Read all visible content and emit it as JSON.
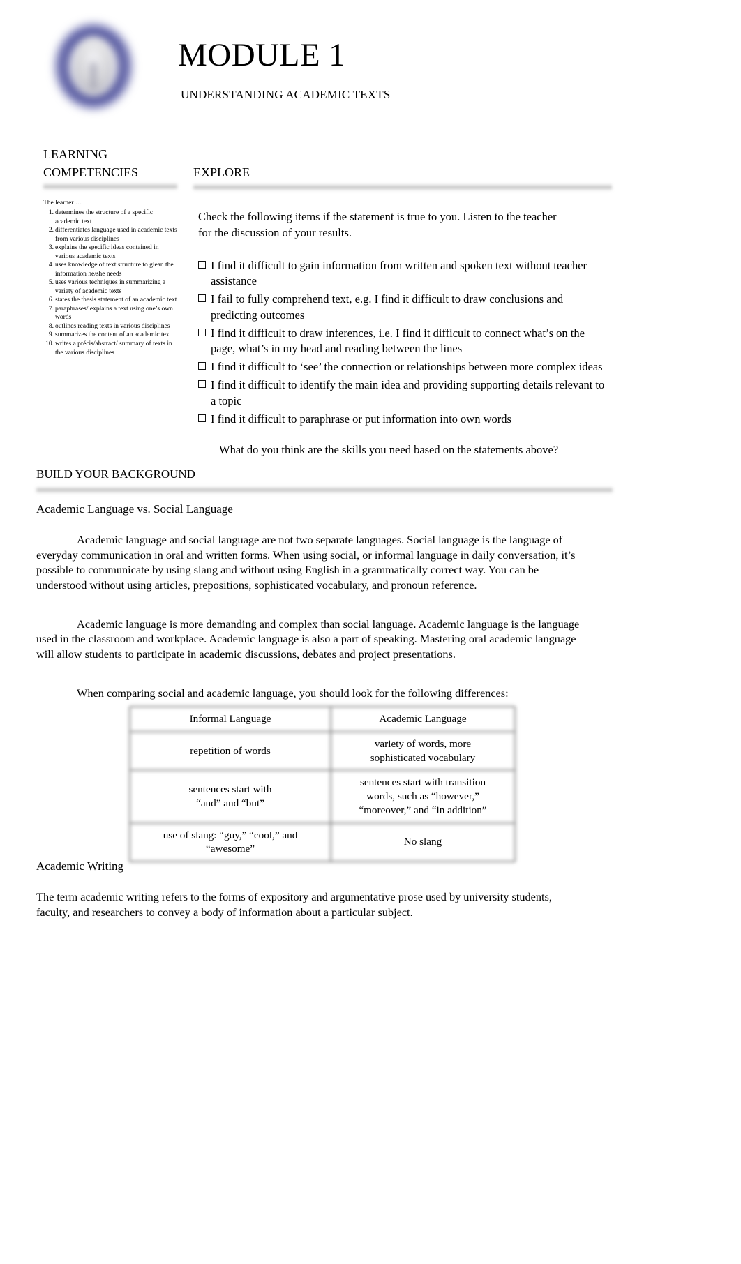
{
  "header": {
    "title": "MODULE 1",
    "subtitle": "UNDERSTANDING ACADEMIC TEXTS",
    "logo_name": "school-seal-logo"
  },
  "competencies": {
    "heading": "LEARNING\nCOMPETENCIES",
    "intro": "The learner …",
    "items": [
      {
        "num": "1.",
        "text": "determines the structure of a specific academic text"
      },
      {
        "num": "2.",
        "text": "differentiates language used in academic texts from various disciplines"
      },
      {
        "num": "3.",
        "text": "explains the specific ideas contained in various academic texts"
      },
      {
        "num": "4.",
        "text": "uses knowledge of text structure to glean the information he/she needs"
      },
      {
        "num": "5.",
        "text": "uses various techniques in summarizing a variety of academic texts"
      },
      {
        "num": "6.",
        "text": "states the thesis statement of an academic text"
      },
      {
        "num": "7.",
        "text": "paraphrases/ explains a text using one’s own words"
      },
      {
        "num": "8.",
        "text": "outlines reading texts in various disciplines"
      },
      {
        "num": "9.",
        "text": "summarizes the content of an academic text"
      },
      {
        "num": "10.",
        "text": "writes a précis/abstract/ summary of texts in the various disciplines"
      }
    ]
  },
  "explore": {
    "heading": "EXPLORE",
    "instructions": "Check the following items if the statement is true to you. Listen to the teacher for the discussion of your results.",
    "checkboxes": [
      "I find it difficult to gain information from written and spoken text without teacher assistance",
      "I fail to fully comprehend text, e.g. I find it difficult to draw conclusions and predicting outcomes",
      "I find it difficult to draw inferences, i.e.    I find it difficult to connect what’s on the page, what’s in my head and reading between the lines",
      "I find it difficult to ‘see’ the connection or relationships between more complex ideas",
      "I find it difficult to identify the main idea and providing supporting details relevant to a topic",
      "I find it difficult to paraphrase or put information into own words"
    ],
    "question": "What do you think are the skills you need based on the statements above?"
  },
  "build_background": {
    "heading": "BUILD YOUR BACKGROUND",
    "subheading": "Academic Language vs. Social Language",
    "paragraph1": "Academic language and social language are not two separate languages. Social language is the language of everyday communication in oral and written forms. When using social, or informal language in daily conversation, it’s possible to communicate by using slang and without using English in a grammatically correct way. You can be understood without using articles, prepositions, sophisticated vocabulary, and pronoun reference.",
    "paragraph2": "Academic language is more demanding and complex than social language. Academic language is the language used in the classroom and workplace. Academic language is also a part of speaking. Mastering oral academic language will allow students to participate in academic discussions, debates and project presentations.",
    "paragraph3": "When comparing social and academic language, you should look for the following differences:"
  },
  "comparison_table": {
    "headers": [
      "Informal Language",
      "Academic Language"
    ],
    "rows": [
      [
        "repetition of words",
        "variety of words, more\nsophisticated vocabulary"
      ],
      [
        "sentences start with\n“and” and “but”",
        "sentences start with transition\nwords, such as “however,”\n“moreover,” and “in addition”"
      ],
      [
        "use of slang: “guy,” “cool,” and\n“awesome”",
        "No slang"
      ]
    ]
  },
  "academic_writing": {
    "subheading": "Academic Writing",
    "paragraph": "The term  academic writing  refers to the forms of    expository  and  argumentative prose    used by university students, faculty, and researchers to convey a body of information about a particular subject."
  }
}
